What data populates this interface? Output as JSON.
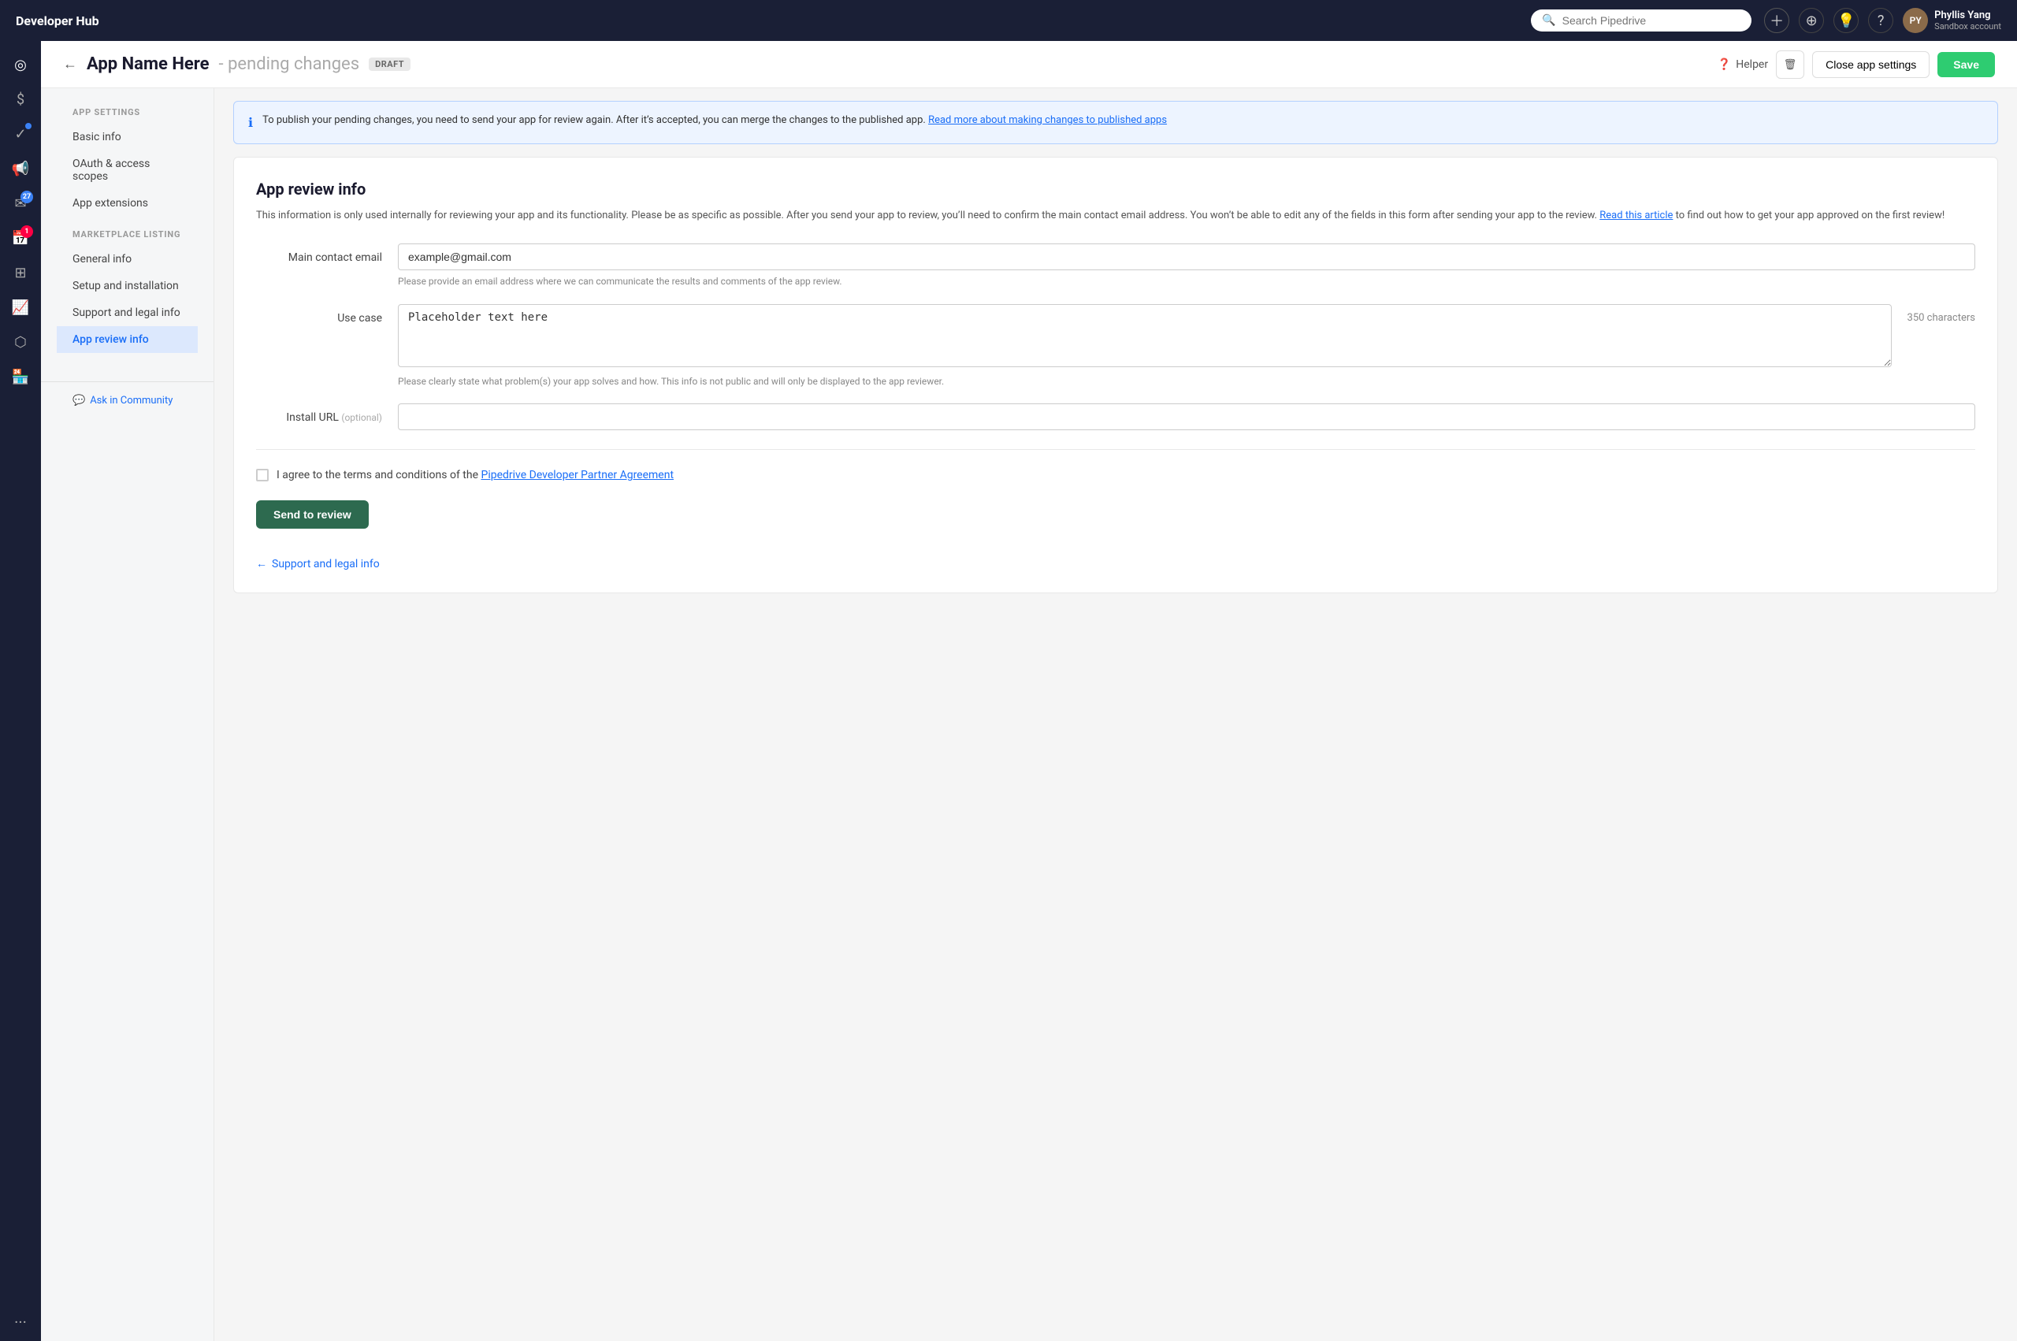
{
  "topNav": {
    "brand": "Developer Hub",
    "searchPlaceholder": "Search Pipedrive",
    "user": {
      "name": "Phyllis Yang",
      "role": "Sandbox account",
      "avatarInitials": "PY"
    },
    "icons": {
      "plugin": "⊕",
      "bulb": "💡",
      "help": "?"
    }
  },
  "pageHeader": {
    "backLabel": "←",
    "appName": "App Name Here",
    "separator": "-",
    "subtitle": "pending changes",
    "badge": "DRAFT",
    "helper": "Helper",
    "deleteTitle": "Delete",
    "closeSettings": "Close app settings",
    "save": "Save"
  },
  "sideNav": {
    "appSettingsLabel": "APP SETTINGS",
    "appSettingsItems": [
      {
        "id": "basic-info",
        "label": "Basic info",
        "active": false
      },
      {
        "id": "oauth-access-scopes",
        "label": "OAuth & access scopes",
        "active": false
      },
      {
        "id": "app-extensions",
        "label": "App extensions",
        "active": false
      }
    ],
    "marketplaceLabel": "MARKETPLACE LISTING",
    "marketplaceItems": [
      {
        "id": "general-info",
        "label": "General info",
        "active": false
      },
      {
        "id": "setup-installation",
        "label": "Setup and installation",
        "active": false
      },
      {
        "id": "support-legal-info",
        "label": "Support and legal info",
        "active": false
      },
      {
        "id": "app-review-info",
        "label": "App review info",
        "active": true
      }
    ],
    "askCommunity": "Ask in Community"
  },
  "infoBanner": {
    "text": "To publish your pending changes, you need to send your app for review again. After it’s accepted, you can merge the changes to the published app.",
    "linkText": "Read more about making changes to published apps",
    "linkHref": "#"
  },
  "formSection": {
    "title": "App review info",
    "description": "This information is only used internally for reviewing your app and its functionality. Please be as specific as possible. After you send your app to review, you’ll need to confirm the main contact email address. You won’t be able to edit any of the fields in this form after sending your app to the review.",
    "descriptionLinkText": "Read this article",
    "descriptionLinkSuffix": " to find out how to get your app approved on the first review!",
    "fields": {
      "mainContactEmail": {
        "label": "Main contact email",
        "value": "example@gmail.com",
        "hint": "Please provide an email address where we can communicate the results and comments of the app review."
      },
      "useCase": {
        "label": "Use case",
        "value": "Placeholder text here",
        "charCount": "350 characters",
        "hint": "Please clearly state what problem(s) your app solves and how. This info is not public and will only be displayed to the app reviewer."
      },
      "installUrl": {
        "label": "Install URL",
        "optionalLabel": "(optional)",
        "value": ""
      }
    },
    "agreementText": "I agree to the terms and conditions of the",
    "agreementLinkText": "Pipedrive Developer Partner Agreement",
    "sendToReview": "Send to review",
    "backNav": {
      "icon": "←",
      "label": "Support and legal info"
    }
  },
  "leftSidebar": {
    "icons": [
      {
        "id": "nav-compass",
        "symbol": "◎",
        "active": true
      },
      {
        "id": "nav-dollar",
        "symbol": "$"
      },
      {
        "id": "nav-megaphone",
        "symbol": "📣",
        "dotIndicator": true
      },
      {
        "id": "nav-inbox",
        "symbol": "✉",
        "badge": "27",
        "badgeColor": "blue"
      },
      {
        "id": "nav-calendar",
        "symbol": "📅",
        "badge": "1",
        "badgeColor": "red"
      },
      {
        "id": "nav-grid",
        "symbol": "⊞"
      },
      {
        "id": "nav-chart",
        "symbol": "📈"
      },
      {
        "id": "nav-cube",
        "symbol": "⬡"
      },
      {
        "id": "nav-store",
        "symbol": "🏪"
      }
    ],
    "dotsIcon": "···"
  }
}
